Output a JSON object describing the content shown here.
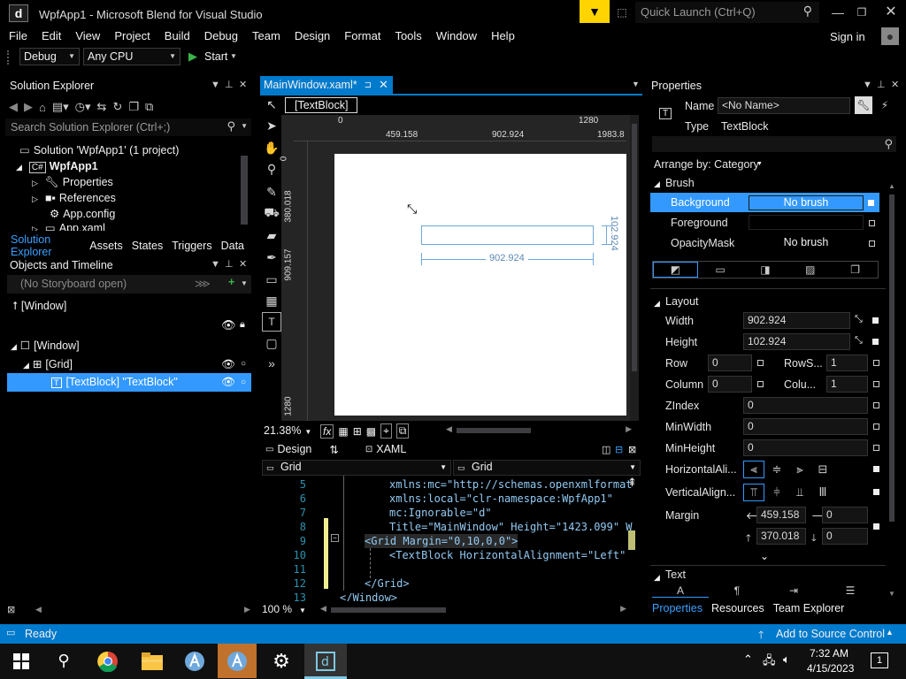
{
  "window": {
    "title": "WpfApp1 - Microsoft Blend for Visual Studio",
    "quick_launch": "Quick Launch (Ctrl+Q)",
    "sign_in": "Sign in"
  },
  "menu": [
    "File",
    "Edit",
    "View",
    "Project",
    "Build",
    "Debug",
    "Team",
    "Design",
    "Format",
    "Tools",
    "Window",
    "Help"
  ],
  "toolbar": {
    "config": "Debug",
    "platform": "Any CPU",
    "start": "Start"
  },
  "solution_explorer": {
    "title": "Solution Explorer",
    "search_placeholder": "Search Solution Explorer (Ctrl+;)",
    "items": [
      "Solution 'WpfApp1' (1 project)",
      "WpfApp1",
      "Properties",
      "References",
      "App.config",
      "App.xaml"
    ],
    "tabs": [
      "Solution Explorer",
      "Assets",
      "States",
      "Triggers",
      "Data"
    ]
  },
  "objects_timeline": {
    "title": "Objects and Timeline",
    "storyboard": "(No Storyboard open)",
    "root": "[Window]",
    "tree": [
      "[Window]",
      "[Grid]",
      "[TextBlock] \"TextBlock\""
    ]
  },
  "document": {
    "tab": "MainWindow.xaml*",
    "breadcrumb": "[TextBlock]",
    "ruler_top": [
      "0",
      "459.158",
      "902.924",
      "1280",
      "1983.8"
    ],
    "ruler_left": [
      "0",
      "380.018",
      "909.157",
      "1280"
    ],
    "width_dim": "902.924",
    "height_dim": "102.924",
    "zoom": "21.38%",
    "design_tab": "Design",
    "xaml_tab": "XAML",
    "scope_left": "Grid",
    "scope_right": "Grid",
    "code_zoom": "100 %",
    "code_lines": [
      {
        "n": "5",
        "text": "xmlns:mc=\"http://schemas.openxmlformat"
      },
      {
        "n": "6",
        "text": "xmlns:local=\"clr-namespace:WpfApp1\""
      },
      {
        "n": "7",
        "text": "mc:Ignorable=\"d\""
      },
      {
        "n": "8",
        "text": "Title=\"MainWindow\" Height=\"1423.099\" W"
      },
      {
        "n": "9",
        "text": "<Grid Margin=\"0,10,0,0\">"
      },
      {
        "n": "10",
        "text": "<TextBlock HorizontalAlignment=\"Left\""
      },
      {
        "n": "11",
        "text": ""
      },
      {
        "n": "12",
        "text": "</Grid>"
      },
      {
        "n": "13",
        "text": "</Window>"
      }
    ]
  },
  "properties": {
    "title": "Properties",
    "name_label": "Name",
    "name_value": "<No Name>",
    "type_label": "Type",
    "type_value": "TextBlock",
    "arrange_by": "Arrange by: Category",
    "brush_section": "Brush",
    "brushes": [
      {
        "label": "Background",
        "value": "No brush"
      },
      {
        "label": "Foreground",
        "value": ""
      },
      {
        "label": "OpacityMask",
        "value": "No brush"
      }
    ],
    "layout_section": "Layout",
    "width_label": "Width",
    "width_value": "902.924",
    "height_label": "Height",
    "height_value": "102.924",
    "row_label": "Row",
    "row_value": "0",
    "rowspan_label": "RowS...",
    "rowspan_value": "1",
    "column_label": "Column",
    "column_value": "0",
    "colspan_label": "Colu...",
    "colspan_value": "1",
    "zindex_label": "ZIndex",
    "zindex_value": "0",
    "minwidth_label": "MinWidth",
    "minwidth_value": "0",
    "minheight_label": "MinHeight",
    "minheight_value": "0",
    "halign_label": "HorizontalAli...",
    "valign_label": "VerticalAlign...",
    "margin_label": "Margin",
    "margin_left": "459.158",
    "margin_right": "0",
    "margin_top": "370.018",
    "margin_bottom": "0",
    "text_section": "Text",
    "tabs": [
      "Properties",
      "Resources",
      "Team Explorer"
    ]
  },
  "statusbar": {
    "status": "Ready",
    "source_control": "Add to Source Control"
  },
  "taskbar": {
    "time": "7:32 AM",
    "date": "4/15/2023",
    "notifications": "1"
  },
  "colors": {
    "accent": "#007acc",
    "selected": "#3399ff",
    "status_bar": "#007acc",
    "code_keyword": "#569cd6",
    "code_string": "#d69d85",
    "code_attr": "#92caf4"
  }
}
